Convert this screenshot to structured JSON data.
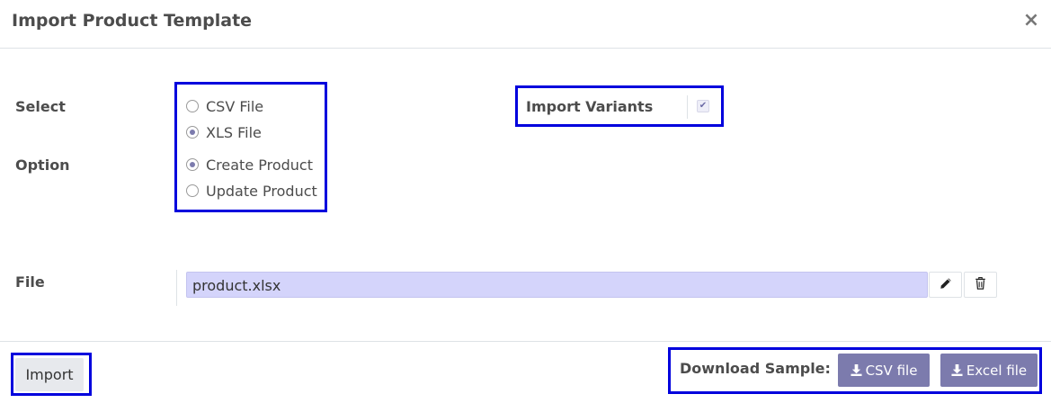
{
  "dialog": {
    "title": "Import Product Template",
    "close_glyph": "×"
  },
  "form": {
    "select_label": "Select",
    "select_options": [
      {
        "label": "CSV File",
        "checked": false
      },
      {
        "label": "XLS File",
        "checked": true
      }
    ],
    "option_label": "Option",
    "option_options": [
      {
        "label": "Create Product",
        "checked": true
      },
      {
        "label": "Update Product",
        "checked": false
      }
    ],
    "import_variants_label": "Import Variants",
    "import_variants_checked": true,
    "file_label": "File",
    "file_value": "product.xlsx"
  },
  "footer": {
    "import_label": "Import",
    "download_label": "Download Sample:",
    "csv_button": "CSV file",
    "excel_button": "Excel file"
  },
  "icons": {
    "edit": "pencil-icon",
    "delete": "trash-icon",
    "download": "download-icon"
  },
  "colors": {
    "primary": "#7c7bad",
    "highlight": "#0000dd",
    "file_bg": "#d4d4fb"
  }
}
